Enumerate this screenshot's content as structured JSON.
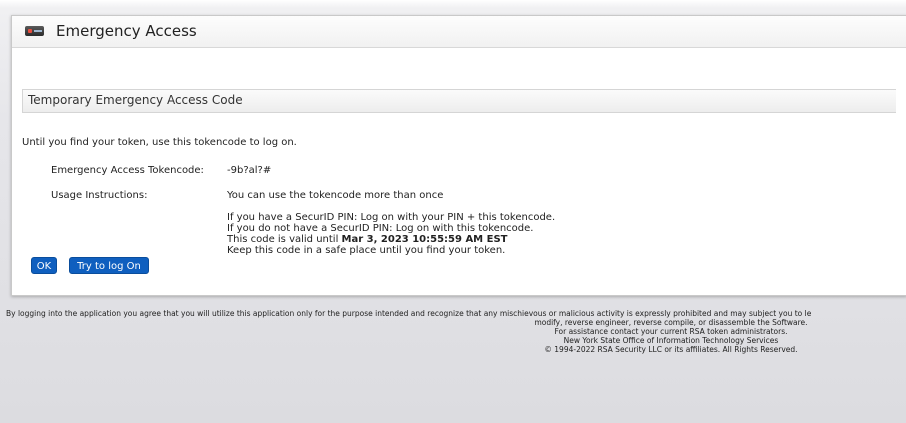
{
  "app": {
    "title": "Emergency Access"
  },
  "section": {
    "title": "Temporary Emergency Access Code"
  },
  "intro": "Until you find your token, use this tokencode to log on.",
  "fields": {
    "tokencode_label": "Emergency Access Tokencode:",
    "tokencode_value": "-9b?al?#",
    "usage_label": "Usage Instructions:",
    "usage_value": "You can use the tokencode more than once"
  },
  "instructions": {
    "line1": "If you have a SecurID PIN: Log on with your PIN + this tokencode.",
    "line2": "If you do not have a SecurID PIN: Log on with this tokencode.",
    "valid_prefix": "This code is valid until ",
    "valid_until": "Mar 3, 2023 10:55:59 AM EST",
    "line4": "Keep this code in a safe place until you find your token."
  },
  "buttons": {
    "ok": "OK",
    "try_logon": "Try to log On"
  },
  "footer": {
    "line1": "By logging into the application you agree that you will utilize this application only for the purpose intended and recognize that any mischievous or malicious activity is expressly prohibited and may subject you to le",
    "line2": "modify, reverse engineer, reverse compile, or disassemble the Software.",
    "line3": "For assistance contact your current RSA token administrators.",
    "line4": "New York State Office of Information Technology Services",
    "line5": "© 1994-2022 RSA Security LLC or its affiliates. All Rights Reserved."
  },
  "icons": {
    "app": "rsa-token-icon"
  }
}
